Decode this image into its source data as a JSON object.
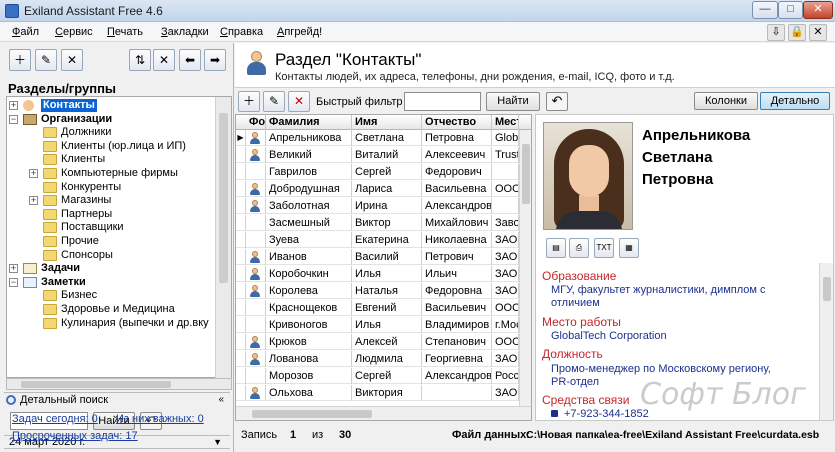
{
  "window": {
    "title": "Exiland Assistant Free 4.6",
    "minimize": "—",
    "maximize": "□",
    "close": "✕"
  },
  "menu": [
    "Файл",
    "Сервис",
    "Печать",
    "Закладки",
    "Справка",
    "Апгрейд!"
  ],
  "left": {
    "groups_title": "Разделы/группы",
    "tree": [
      {
        "label": "Контакты",
        "level": 0,
        "expander": "+",
        "icon": "contacts-icon",
        "selected": true,
        "bold": true
      },
      {
        "label": "Организации",
        "level": 0,
        "expander": "−",
        "icon": "organizations-icon",
        "bold": true
      },
      {
        "label": "Должники",
        "level": 1,
        "icon": "folder-icon"
      },
      {
        "label": "Клиенты (юр.лица и ИП)",
        "level": 1,
        "icon": "folder-icon"
      },
      {
        "label": "Клиенты",
        "level": 1,
        "icon": "folder-icon"
      },
      {
        "label": "Компьютерные фирмы",
        "level": 1,
        "expander": "+",
        "icon": "folder-icon"
      },
      {
        "label": "Конкуренты",
        "level": 1,
        "icon": "folder-icon"
      },
      {
        "label": "Магазины",
        "level": 1,
        "expander": "+",
        "icon": "folder-icon"
      },
      {
        "label": "Партнеры",
        "level": 1,
        "icon": "folder-icon"
      },
      {
        "label": "Поставщики",
        "level": 1,
        "icon": "folder-icon"
      },
      {
        "label": "Прочие",
        "level": 1,
        "icon": "folder-icon"
      },
      {
        "label": "Спонсоры",
        "level": 1,
        "icon": "folder-icon"
      },
      {
        "label": "Задачи",
        "level": 0,
        "expander": "+",
        "icon": "tasks-icon",
        "bold": true
      },
      {
        "label": "Заметки",
        "level": 0,
        "expander": "−",
        "icon": "notes-icon",
        "bold": true
      },
      {
        "label": "Бизнес",
        "level": 1,
        "icon": "folder-icon"
      },
      {
        "label": "Здоровье и Медицина",
        "level": 1,
        "icon": "folder-icon"
      },
      {
        "label": "Кулинария (выпечки и др.вку",
        "level": 1,
        "icon": "folder-icon"
      }
    ],
    "search": {
      "title": "Детальный поиск",
      "value": "",
      "button": "Найти",
      "collapse": "«"
    },
    "date": "24 март 2020 г.",
    "tasks_today": "Задач сегодня: 0",
    "tasks_important": "Из них важных: 0",
    "tasks_overdue": "Просроченных задач: 17"
  },
  "section": {
    "title": "Раздел \"Контакты\"",
    "subtitle": "Контакты людей, их адреса, телефоны, дни рождения, e-mail, ICQ, фото и т.д."
  },
  "toolbar": {
    "filter_label": "Быстрый фильтр",
    "filter_value": "",
    "find_button": "Найти",
    "columns_button": "Колонки",
    "detail_button": "Детально"
  },
  "grid": {
    "headers": [
      "Фото",
      "Фамилия",
      "Имя",
      "Отчество",
      "Место"
    ],
    "rows": [
      {
        "photo": true,
        "last": "Апрельникова",
        "first": "Светлана",
        "middle": "Петровна",
        "place": "GlobalT",
        "current": true
      },
      {
        "photo": true,
        "last": "Великий",
        "first": "Виталий",
        "middle": "Алексеевич",
        "place": "Trust"
      },
      {
        "photo": false,
        "last": "Гаврилов",
        "first": "Сергей",
        "middle": "Федорович",
        "place": ""
      },
      {
        "photo": true,
        "last": "Добродушная",
        "first": "Лариса",
        "middle": "Васильевна",
        "place": "ООО"
      },
      {
        "photo": true,
        "last": "Заболотная",
        "first": "Ирина",
        "middle": "Александров",
        "place": ""
      },
      {
        "photo": false,
        "last": "Засмешный",
        "first": "Виктор",
        "middle": "Михайлович",
        "place": "Заво"
      },
      {
        "photo": false,
        "last": "Зуева",
        "first": "Екатерина",
        "middle": "Николаевна",
        "place": "ЗАО"
      },
      {
        "photo": true,
        "last": "Иванов",
        "first": "Василий",
        "middle": "Петрович",
        "place": "ЗАО"
      },
      {
        "photo": true,
        "last": "Коробочкин",
        "first": "Илья",
        "middle": "Ильич",
        "place": "ЗАО"
      },
      {
        "photo": true,
        "last": "Королева",
        "first": "Наталья",
        "middle": "Федоровна",
        "place": "ЗАО"
      },
      {
        "photo": false,
        "last": "Краснощеков",
        "first": "Евгений",
        "middle": "Васильевич",
        "place": "ООО"
      },
      {
        "photo": false,
        "last": "Кривоногов",
        "first": "Илья",
        "middle": "Владимиров",
        "place": "г.Мос"
      },
      {
        "photo": true,
        "last": "Крюков",
        "first": "Алексей",
        "middle": "Степанович",
        "place": "ООО"
      },
      {
        "photo": true,
        "last": "Лованова",
        "first": "Людмила",
        "middle": "Георгиевна",
        "place": "ЗАО"
      },
      {
        "photo": false,
        "last": "Морозов",
        "first": "Сергей",
        "middle": "Александров",
        "place": "Росси"
      },
      {
        "photo": true,
        "last": "Ольхова",
        "first": "Виктория",
        "middle": "",
        "place": "ЗАО"
      }
    ]
  },
  "detail": {
    "name_line1": "Апрельникова",
    "name_line2": "Светлана",
    "name_line3": "Петровна",
    "education_label": "Образование",
    "education_value": "МГУ, факультет журналистики, димплом с отличием",
    "work_label": "Место работы",
    "work_value": "GlobalTech Corporation",
    "position_label": "Должность",
    "position_value": "Промо-менеджер по Московскому региону, PR-отдел",
    "contacts_label": "Средства связи",
    "phone_value": "+7-923-344-1852"
  },
  "status": {
    "record_label": "Запись",
    "record_num": "1",
    "of_label": "из",
    "record_total": "30",
    "file_label": "Файл данных:",
    "file_path": "C:\\Новая папка\\ea-free\\Exiland Assistant Free\\curdata.esb"
  },
  "watermark": "Софт Блог"
}
